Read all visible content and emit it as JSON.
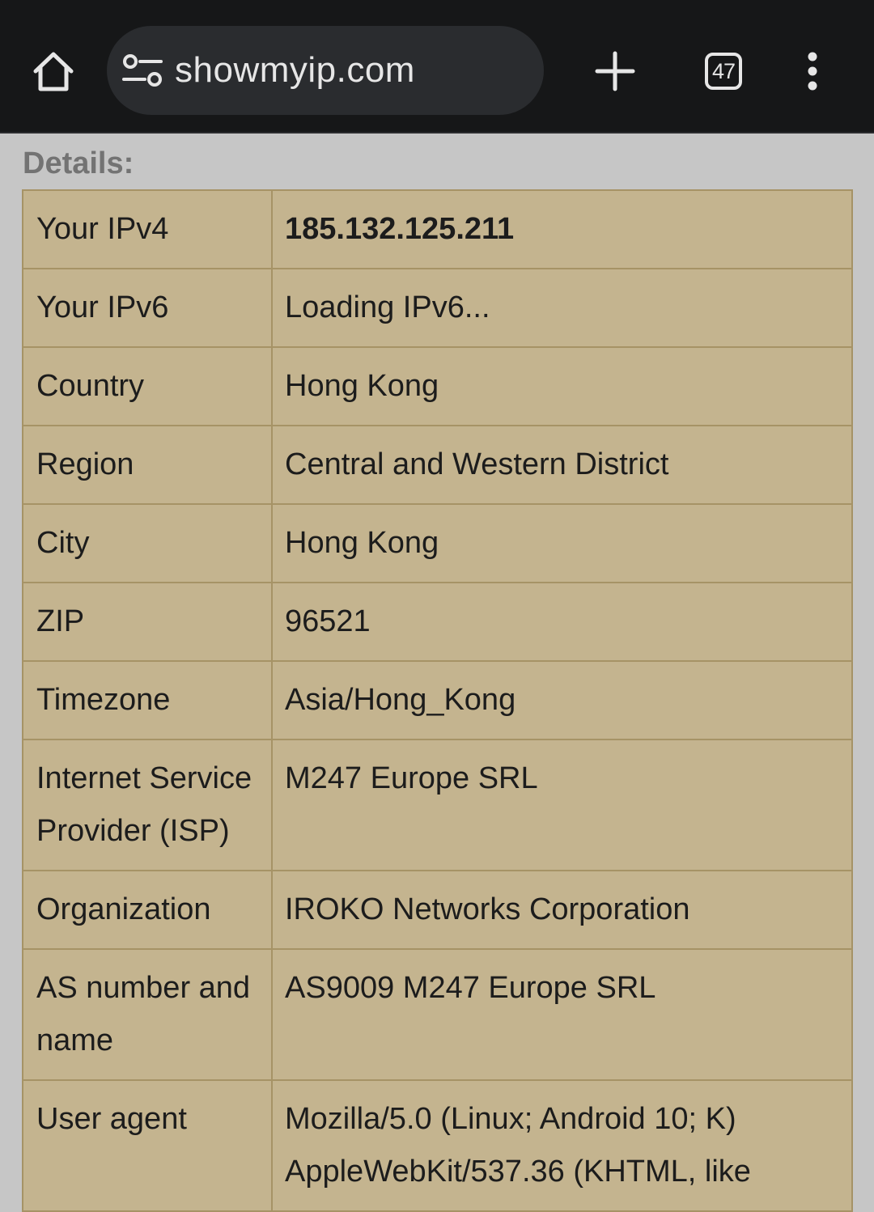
{
  "browser": {
    "url": "showmyip.com",
    "tab_count": "47",
    "icons": {
      "home": "home-icon",
      "site_info": "tune-icon",
      "new_tab": "plus-icon",
      "tab_switcher": "tab-counter-icon",
      "menu": "more-vert-icon"
    }
  },
  "page": {
    "heading": "Details:",
    "rows": [
      {
        "label": "Your IPv4",
        "value": "185.132.125.211"
      },
      {
        "label": "Your IPv6",
        "value": "Loading IPv6..."
      },
      {
        "label": "Country",
        "value": "Hong Kong"
      },
      {
        "label": "Region",
        "value": "Central and Western District"
      },
      {
        "label": "City",
        "value": "Hong Kong"
      },
      {
        "label": "ZIP",
        "value": "96521"
      },
      {
        "label": "Timezone",
        "value": "Asia/Hong_Kong"
      },
      {
        "label": "Internet Service Provider (ISP)",
        "value": "M247 Europe SRL"
      },
      {
        "label": "Organization",
        "value": "IROKO Networks Corporation"
      },
      {
        "label": "AS number and name",
        "value": "AS9009 M247 Europe SRL"
      },
      {
        "label": "User agent",
        "value": "Mozilla/5.0 (Linux; Android 10; K) AppleWebKit/537.36 (KHTML, like"
      }
    ]
  },
  "colors": {
    "toolbar_bg": "#161718",
    "omnibox_bg": "#2a2c2f",
    "page_bg": "#c6c6c6",
    "table_bg": "#c4b48f",
    "table_border": "#a69366",
    "heading_text": "#737373"
  }
}
